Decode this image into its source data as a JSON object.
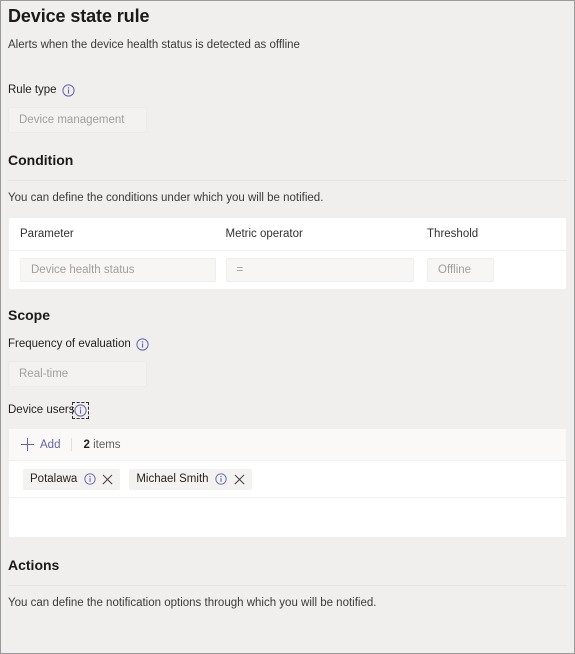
{
  "header": {
    "title": "Device state rule",
    "subtitle": "Alerts when the device health status is detected as offline"
  },
  "rule_type": {
    "label": "Rule type",
    "info_icon": "info-icon",
    "value": "Device management"
  },
  "condition": {
    "heading": "Condition",
    "description": "You can define the conditions under which you will be notified.",
    "columns": [
      "Parameter",
      "Metric operator",
      "Threshold"
    ],
    "row": {
      "parameter": "Device health status",
      "metric_operator": "=",
      "threshold": "Offline"
    }
  },
  "scope": {
    "heading": "Scope",
    "frequency": {
      "label": "Frequency of evaluation",
      "info_icon": "info-icon",
      "value": "Real-time"
    },
    "device_users": {
      "label": "Device users",
      "info_icon": "info-icon",
      "toolbar": {
        "add_label": "Add",
        "add_icon": "plus-icon",
        "count_value": "2",
        "count_label": "items"
      },
      "chips": [
        {
          "name": "Potalawa",
          "info_icon": "info-icon",
          "close_icon": "close-icon"
        },
        {
          "name": "Michael Smith",
          "info_icon": "info-icon",
          "close_icon": "close-icon"
        }
      ]
    }
  },
  "actions": {
    "heading": "Actions",
    "description": "You can define the notification options through which you will be notified."
  },
  "colors": {
    "accent": "#6264a7",
    "page_background": "#f0efee",
    "panel_background": "#ffffff",
    "text_primary": "#201f1e",
    "text_secondary": "#605e5c",
    "text_disabled": "#a19f9d"
  }
}
